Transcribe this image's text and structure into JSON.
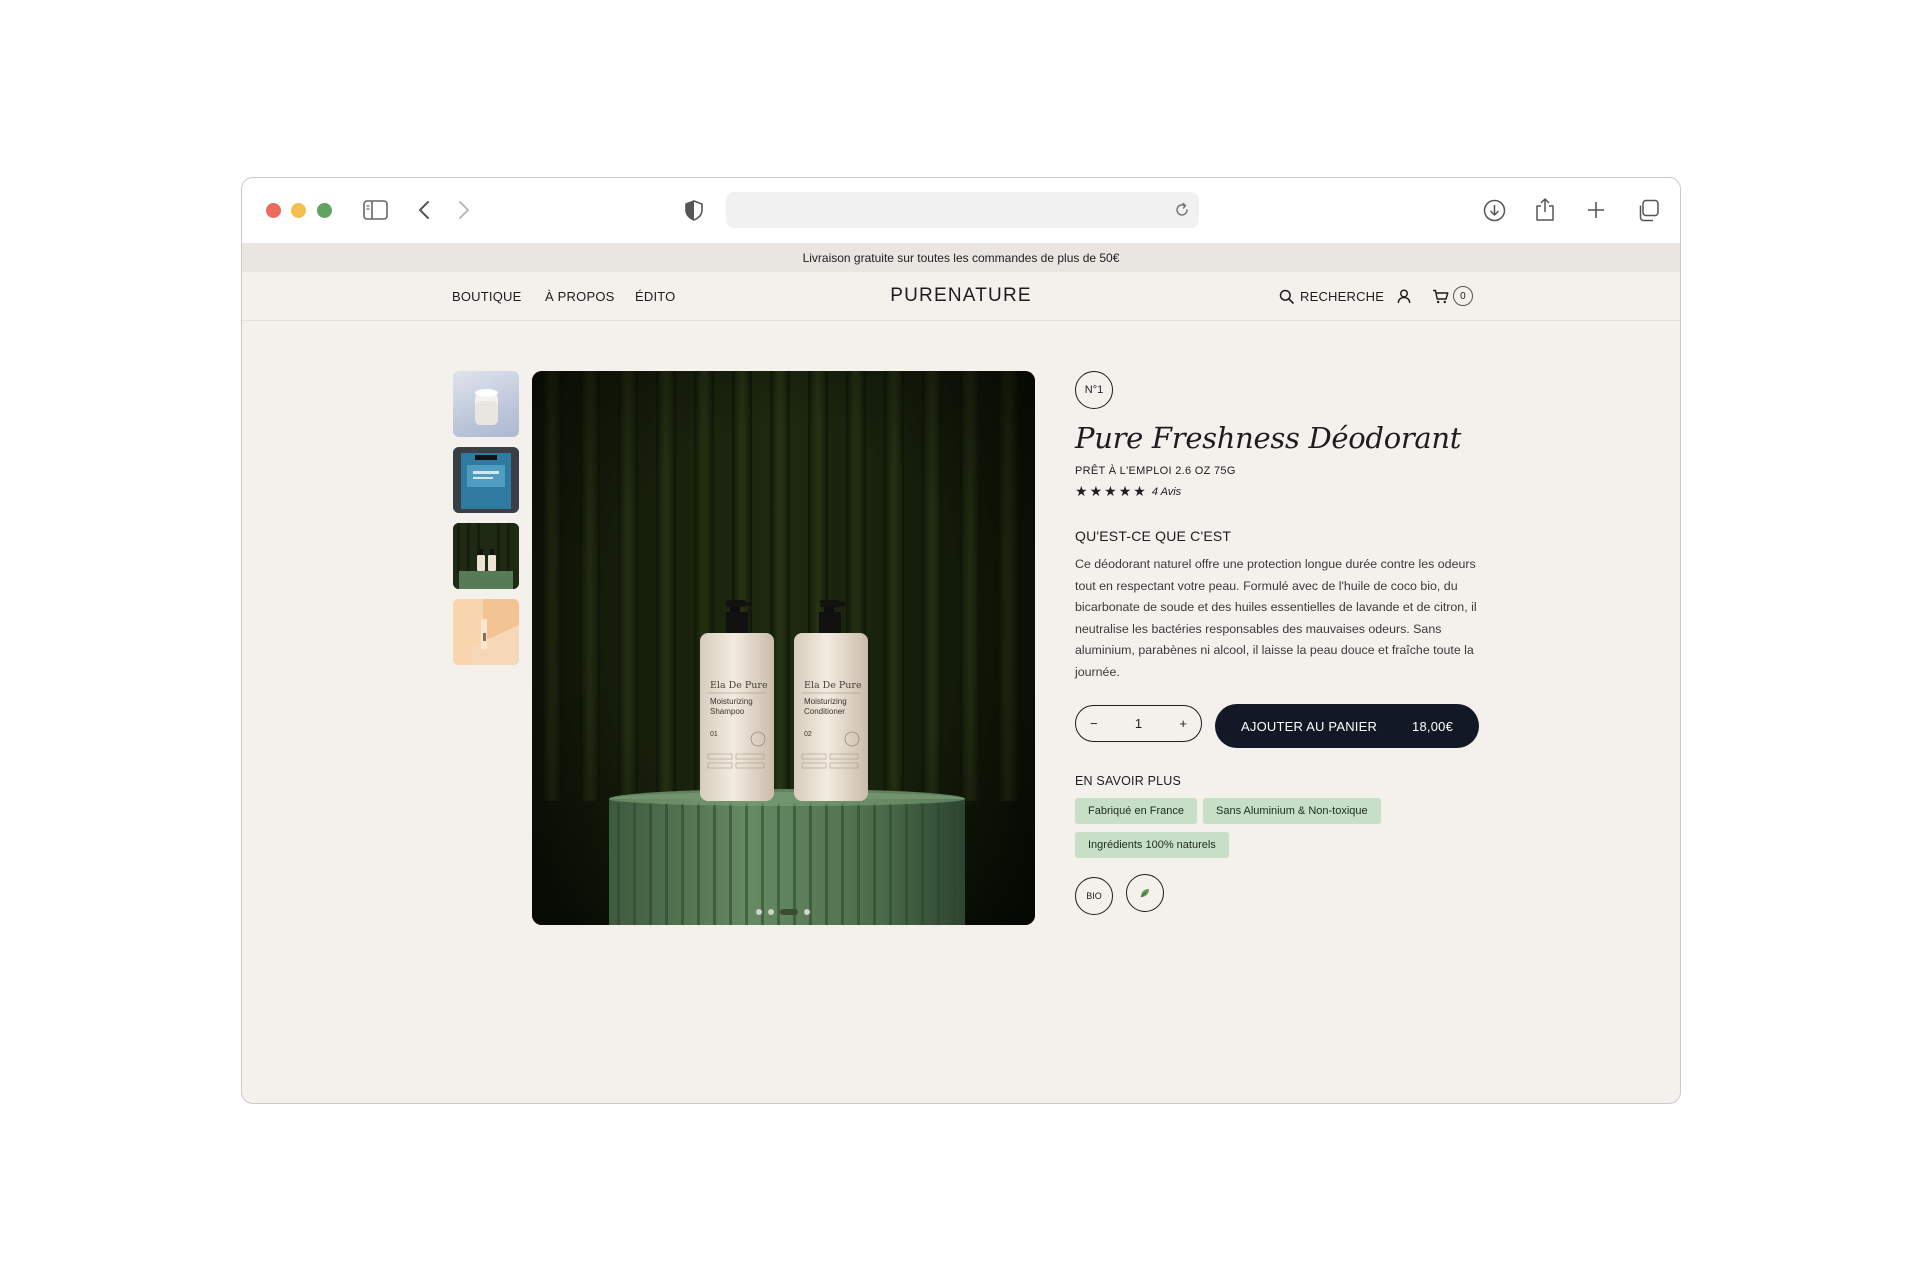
{
  "announcement": "Livraison gratuite sur toutes les commandes de plus de 50€",
  "nav": {
    "left": [
      "BOUTIQUE",
      "À PROPOS",
      "ÉDITO"
    ],
    "brand": "PURENATURE",
    "search_label": "RECHERCHE",
    "cart_count": "0"
  },
  "gallery": {
    "thumbnails": [
      "thumb-jar",
      "thumb-blue-box",
      "thumb-bottles",
      "thumb-peach"
    ],
    "selected_index": 2,
    "main_image": {
      "bottle_brand": "Ela De Pure",
      "bottles": [
        {
          "line1": "Moisturizing",
          "line2": "Shampoo",
          "num": "01"
        },
        {
          "line1": "Moisturizing",
          "line2": "Conditioner",
          "num": "02"
        }
      ]
    },
    "dots_total": 4,
    "dots_active": 2
  },
  "product": {
    "badge": "N°1",
    "title": "Pure Freshness Déodorant",
    "subtitle": "PRÊT À L'EMPLOI 2.6 OZ 75G",
    "stars": 5,
    "reviews": "4 Avis",
    "section_title": "QU'EST-CE QUE C'EST",
    "description": "Ce déodorant naturel offre une protection longue durée contre les odeurs tout en respectant votre peau. Formulé avec de l'huile de coco bio, du bicarbonate de soude et des huiles essentielles de lavande et de citron, il neutralise les bactéries responsables des mauvaises odeurs. Sans aluminium, parabènes ni alcool, il laisse la peau douce et fraîche toute la journée.",
    "quantity": "1",
    "minus": "−",
    "plus": "+",
    "cart_label": "AJOUTER AU PANIER",
    "price": "18,00€",
    "more_title": "EN SAVOIR PLUS",
    "tags": [
      "Fabriqué en France",
      "Sans Aluminium & Non-toxique",
      "Ingrédients 100% naturels"
    ],
    "badges": [
      "BIO",
      "leaf-icon"
    ]
  },
  "colors": {
    "page_bg": "#f4f0ec",
    "button_dark": "#121826",
    "tag_green": "#c8dfc7",
    "traffic_red": "#ed6a5e",
    "traffic_yellow": "#f5bf4f",
    "traffic_green": "#61c554"
  }
}
